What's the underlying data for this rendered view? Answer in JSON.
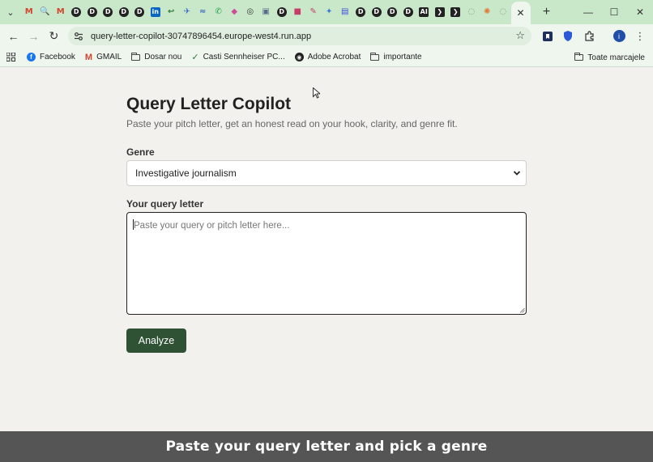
{
  "browser": {
    "tab_favicons": [
      {
        "icon": "gmail-icon",
        "glyph": "M",
        "color": "#d4452d"
      },
      {
        "icon": "search-orange-icon",
        "glyph": "🔍",
        "color": "#e8822a"
      },
      {
        "icon": "gmail-icon",
        "glyph": "M",
        "color": "#d4452d"
      },
      {
        "icon": "d-app-icon",
        "glyph": "D",
        "color": "#222222"
      },
      {
        "icon": "d-app-icon",
        "glyph": "D",
        "color": "#222222"
      },
      {
        "icon": "d-app-icon",
        "glyph": "D",
        "color": "#222222"
      },
      {
        "icon": "d-app-icon",
        "glyph": "D",
        "color": "#222222"
      },
      {
        "icon": "d-app-icon",
        "glyph": "D",
        "color": "#222222"
      },
      {
        "icon": "linkedin-icon",
        "glyph": "in",
        "color": "#0a66c2"
      },
      {
        "icon": "arrow-icon",
        "glyph": "↩",
        "color": "#2d7b3a"
      },
      {
        "icon": "plane-icon",
        "glyph": "✈",
        "color": "#3a6ac9"
      },
      {
        "icon": "wave-icon",
        "glyph": "≈",
        "color": "#3a6ac9"
      },
      {
        "icon": "whatsapp-icon",
        "glyph": "✆",
        "color": "#25a244"
      },
      {
        "icon": "colorful-app-icon",
        "glyph": "◆",
        "color": "#d04a9a"
      },
      {
        "icon": "target-icon",
        "glyph": "◎",
        "color": "#333333"
      },
      {
        "icon": "image-icon",
        "glyph": "▣",
        "color": "#5a6c8a"
      },
      {
        "icon": "d-app-icon",
        "glyph": "D",
        "color": "#222222"
      },
      {
        "icon": "puzzle-pink-icon",
        "glyph": "■",
        "color": "#c93b6a"
      },
      {
        "icon": "tool-pink-icon",
        "glyph": "✎",
        "color": "#c93b6a"
      },
      {
        "icon": "multicolor-icon",
        "glyph": "✦",
        "color": "#3a7bd5"
      },
      {
        "icon": "chat-blue-icon",
        "glyph": "▤",
        "color": "#3b4de0"
      },
      {
        "icon": "d-app-icon",
        "glyph": "D",
        "color": "#222222"
      },
      {
        "icon": "d-app-icon",
        "glyph": "D",
        "color": "#222222"
      },
      {
        "icon": "d-app-icon",
        "glyph": "D",
        "color": "#222222"
      },
      {
        "icon": "d-app-icon",
        "glyph": "D",
        "color": "#222222"
      },
      {
        "icon": "ai-icon",
        "glyph": "AI",
        "color": "#222222"
      },
      {
        "icon": "terminal-icon",
        "glyph": "❯",
        "color": "#222222"
      },
      {
        "icon": "terminal-icon",
        "glyph": "❯",
        "color": "#222222"
      },
      {
        "icon": "gray-circle-icon",
        "glyph": "◌",
        "color": "#8a8a8a"
      },
      {
        "icon": "sun-orange-icon",
        "glyph": "✺",
        "color": "#e07a3a"
      },
      {
        "icon": "gray-circle-icon",
        "glyph": "◌",
        "color": "#8a8a8a"
      }
    ],
    "url": "query-letter-copilot-30747896454.europe-west4.run.app",
    "bookmarks": [
      {
        "label": "Facebook",
        "icon": "facebook-icon"
      },
      {
        "label": "GMAIL",
        "icon": "gmail-icon"
      },
      {
        "label": "Dosar nou",
        "icon": "folder-icon"
      },
      {
        "label": "Casti Sennheiser PC...",
        "icon": "check-icon"
      },
      {
        "label": "Adobe Acrobat",
        "icon": "globe-icon"
      },
      {
        "label": "importante",
        "icon": "folder-icon"
      }
    ],
    "all_bookmarks_label": "Toate marcajele",
    "profile_initial": "i"
  },
  "app": {
    "title": "Query Letter Copilot",
    "subtitle": "Paste your pitch letter, get an honest read on your hook, clarity, and genre fit.",
    "genre_label": "Genre",
    "genre_value": "Investigative journalism",
    "letter_label": "Your query letter",
    "letter_placeholder": "Paste your query or pitch letter here...",
    "analyze_label": "Analyze"
  },
  "caption": "Paste your query letter and pick a genre"
}
